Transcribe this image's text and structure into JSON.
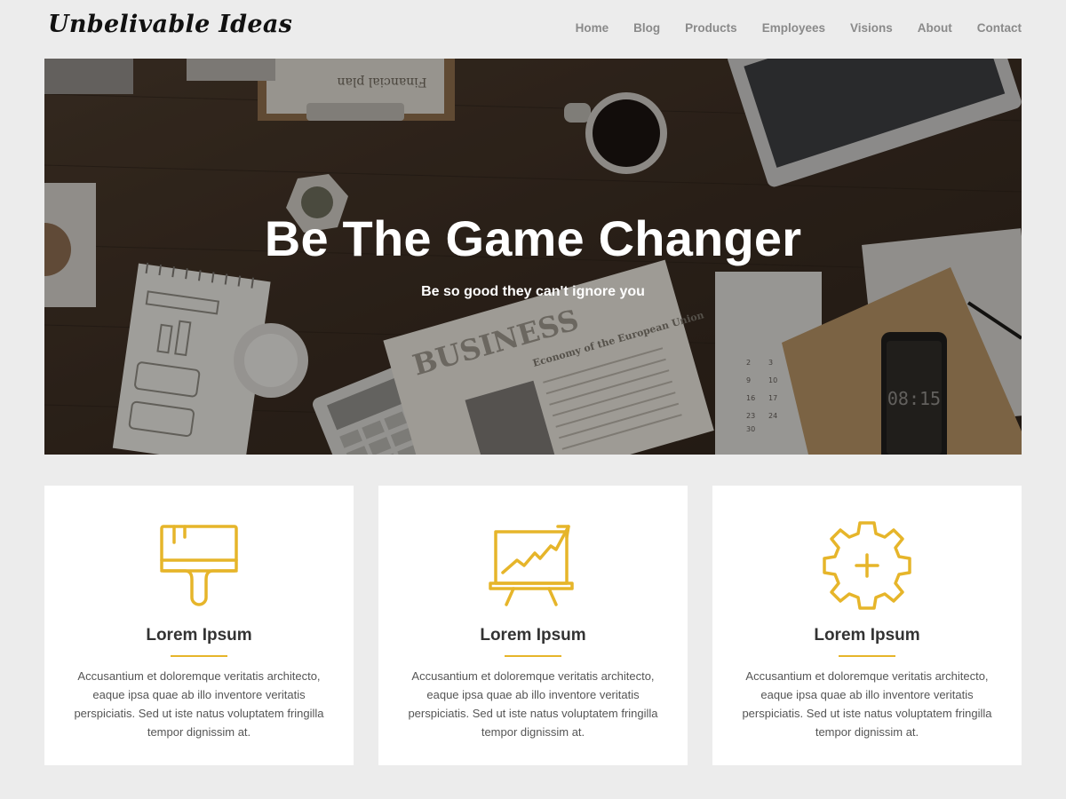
{
  "header": {
    "logo": "Unbelivable Ideas",
    "nav": [
      "Home",
      "Blog",
      "Products",
      "Employees",
      "Visions",
      "About",
      "Contact"
    ]
  },
  "hero": {
    "title": "Be The Game Changer",
    "subtitle": "Be so good they can't ignore you",
    "image_text": {
      "clipboard": "Financial plan",
      "newspaper": "BUSINESS",
      "headline": "Economy of the European Union",
      "phone_time": "08:15"
    }
  },
  "cards": [
    {
      "icon": "paint-brush-icon",
      "title": "Lorem Ipsum",
      "text": "Accusantium et doloremque veritatis architecto, eaque ipsa quae ab illo inventore veritatis perspiciatis. Sed ut iste natus voluptatem fringilla tempor dignissim at."
    },
    {
      "icon": "growth-chart-board-icon",
      "title": "Lorem Ipsum",
      "text": "Accusantium et doloremque veritatis architecto, eaque ipsa quae ab illo inventore veritatis perspiciatis. Sed ut iste natus voluptatem fringilla tempor dignissim at."
    },
    {
      "icon": "gear-plus-icon",
      "title": "Lorem Ipsum",
      "text": "Accusantium et doloremque veritatis architecto, eaque ipsa quae ab illo inventore veritatis perspiciatis. Sed ut iste natus voluptatem fringilla tempor dignissim at."
    }
  ],
  "colors": {
    "accent": "#e6b52a",
    "page_background": "#ececec",
    "nav_text": "#8a8a8a"
  }
}
